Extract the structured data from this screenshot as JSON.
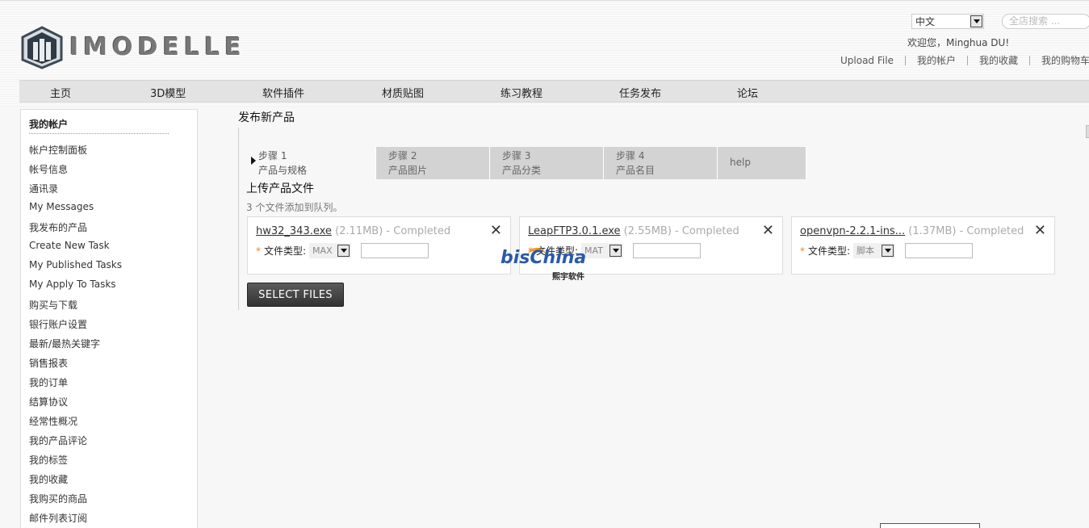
{
  "brand": {
    "logo_text": "IMODELLE"
  },
  "header": {
    "language": "中文",
    "search_placeholder": "全店搜索 ...",
    "welcome": "欢迎您，Minghua DU!",
    "links": [
      "Upload File",
      "我的帐户",
      "我的收藏",
      "我的购物车"
    ]
  },
  "nav": {
    "items": [
      "主页",
      "3D模型",
      "软件插件",
      "材质贴图",
      "练习教程",
      "任务发布",
      "论坛"
    ]
  },
  "sidebar": {
    "title": "我的帐户",
    "items": [
      "帐户控制面板",
      "帐号信息",
      "通讯录",
      "My Messages",
      "我发布的产品",
      "Create New Task",
      "My Published Tasks",
      "My Apply To Tasks",
      "购买与下载",
      "银行账户设置",
      "最新/最热关键字",
      "销售报表",
      "我的订单",
      "结算协议",
      "经常性概况",
      "我的产品评论",
      "我的标签",
      "我的收藏",
      "我购买的商品",
      "邮件列表订阅"
    ]
  },
  "main": {
    "title": "发布新产品",
    "tabs": [
      {
        "step": "步骤 1",
        "label": "产品与规格"
      },
      {
        "step": "步骤 2",
        "label": "产品图片"
      },
      {
        "step": "步骤 3",
        "label": "产品分类"
      },
      {
        "step": "步骤 4",
        "label": "产品名目"
      },
      {
        "step": "help",
        "label": ""
      }
    ],
    "upload_title": "上传产品文件",
    "queue_status": "3 个文件添加到队列。",
    "type_label": "文件类型:",
    "files": [
      {
        "name": "hw32_343.exe",
        "meta": "(2.11MB) - Completed",
        "type": "MAX"
      },
      {
        "name": "LeapFTP3.0.1.exe",
        "meta": "(2.55MB) - Completed",
        "type": "MAT"
      },
      {
        "name": "openvpn-2.2.1-ins...",
        "meta": "(1.37MB) - Completed",
        "type": "脚本"
      }
    ],
    "select_files_label": "SELECT FILES"
  },
  "watermark": {
    "main": "bisChina",
    "sub": "熙宇软件"
  },
  "icons": [
    "logo-cube-icon",
    "dropdown-arrow-icon",
    "close-icon",
    "step-pointer-icon"
  ],
  "colors": {
    "nav_bg": "#e3e3e4",
    "tab_bg": "#d3d3d3",
    "button_bg": "#3a3a3a",
    "required": "#e08a2a"
  }
}
